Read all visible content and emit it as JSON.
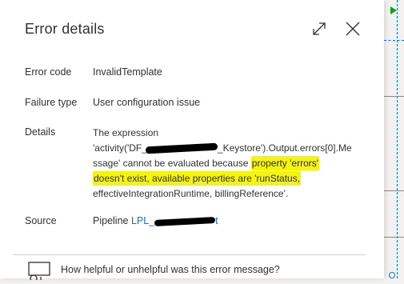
{
  "panel": {
    "title": "Error details",
    "rows": {
      "error_code": {
        "label": "Error code",
        "value": "InvalidTemplate"
      },
      "failure_type": {
        "label": "Failure type",
        "value": "User configuration issue"
      },
      "details": {
        "label": "Details",
        "line1": "The expression",
        "line2_a": "'activity('DF_",
        "line2_b": "_Keystore').Output.errors[0].Me",
        "line3_a": "ssage' cannot be evaluated because ",
        "line3_b": "property 'errors'",
        "line4": "doesn't exist, available properties are 'runStatus,",
        "line5": "effectiveIntegrationRuntime, billingReference'."
      },
      "source": {
        "label": "Source",
        "prefix": "Pipeline",
        "link_text": "LPL_",
        "link_suffix": "t"
      }
    },
    "feedback": {
      "text": "How helpful or unhelpful was this error message?"
    }
  },
  "icons": {
    "expand": "expand-icon",
    "close": "close-icon",
    "feedback": "feedback-icon",
    "run": "play-icon"
  },
  "colors": {
    "link": "#0078d4",
    "highlight": "#f4f40f",
    "success": "#13a10e"
  }
}
